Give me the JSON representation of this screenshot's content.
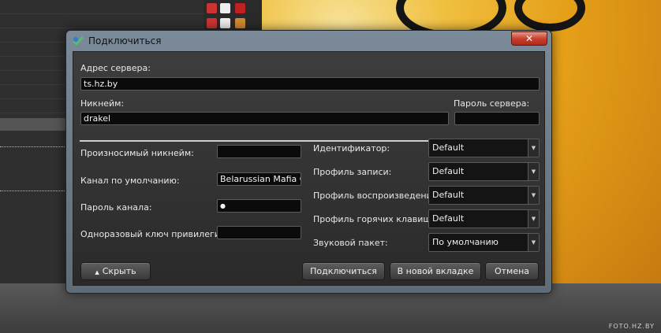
{
  "dialog": {
    "title": "Подключиться",
    "close_label": "✕",
    "server_address_label": "Адрес сервера:",
    "server_address_value": "ts.hz.by",
    "nickname_label": "Никнейм:",
    "nickname_value": "drakel",
    "server_password_label": "Пароль сервера:",
    "server_password_value": "",
    "left_fields": [
      {
        "label": "Произносимый никнейм:",
        "value": ""
      },
      {
        "label": "Канал по умолчанию:",
        "value": "Belarussian Mafia Crew"
      },
      {
        "label": "Пароль канала:",
        "value": "●"
      },
      {
        "label": "Одноразовый ключ привилегий:",
        "value": ""
      }
    ],
    "right_fields": [
      {
        "label": "Идентификатор:",
        "value": "Default"
      },
      {
        "label": "Профиль записи:",
        "value": "Default"
      },
      {
        "label": "Профиль воспроизведения:",
        "value": "Default"
      },
      {
        "label": "Профиль горячих клавиш:",
        "value": "Default"
      },
      {
        "label": "Звуковой пакет:",
        "value": "По умолчанию"
      }
    ],
    "buttons": {
      "hide": "Скрыть",
      "connect": "Подключиться",
      "new_tab": "В новой вкладке",
      "cancel": "Отмена"
    }
  },
  "watermark": "FOTO.HZ.BY"
}
